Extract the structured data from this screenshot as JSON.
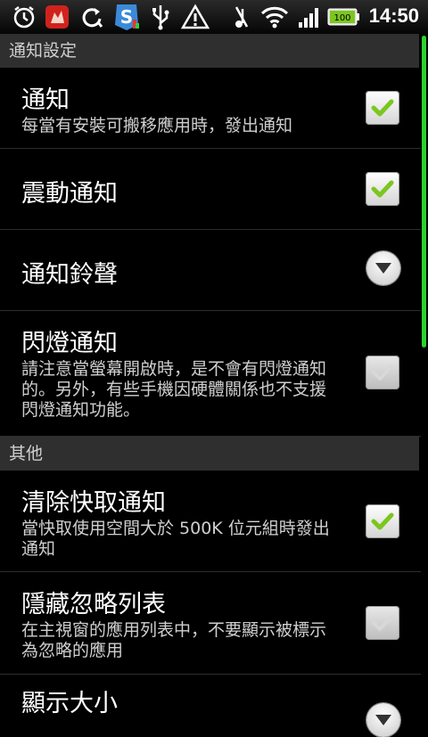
{
  "status_bar": {
    "time": "14:50",
    "battery_level": "100",
    "icons": [
      "alarm-icon",
      "app-notification-icon",
      "sync-icon",
      "s-app-icon",
      "usb-icon",
      "warning-icon",
      "mute-icon",
      "wifi-icon",
      "signal-icon",
      "battery-icon"
    ]
  },
  "sections": [
    {
      "header": "通知設定",
      "items": [
        {
          "title": "通知",
          "summary": "每當有安裝可搬移應用時，發出通知",
          "control": "checkbox",
          "checked": true
        },
        {
          "title": "震動通知",
          "summary": "",
          "control": "checkbox",
          "checked": true
        },
        {
          "title": "通知鈴聲",
          "summary": "",
          "control": "dropdown"
        },
        {
          "title": "閃燈通知",
          "summary": "請注意當螢幕開啟時，是不會有閃燈通知的。另外，有些手機因硬體關係也不支援閃燈通知功能。",
          "control": "checkbox",
          "checked": false
        }
      ]
    },
    {
      "header": "其他",
      "items": [
        {
          "title": "清除快取通知",
          "summary": "當快取使用空間大於 500K 位元組時發出通知",
          "control": "checkbox",
          "checked": true
        },
        {
          "title": "隱藏忽略列表",
          "summary": "在主視窗的應用列表中，不要顯示被標示為忽略的應用",
          "control": "checkbox",
          "checked": false
        },
        {
          "title": "顯示大小",
          "summary": "",
          "control": "dropdown"
        }
      ]
    }
  ],
  "colors": {
    "accent": "#7cc61f",
    "scrollbar": "#2fd12f",
    "header_bg": "#2f2f2f"
  }
}
